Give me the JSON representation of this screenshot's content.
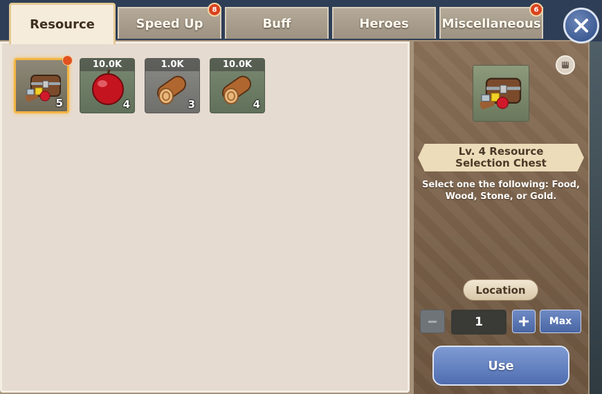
{
  "tabs": [
    {
      "label": "Resource",
      "active": true,
      "badge": null
    },
    {
      "label": "Speed Up",
      "active": false,
      "badge": "8"
    },
    {
      "label": "Buff",
      "active": false,
      "badge": null
    },
    {
      "label": "Heroes",
      "active": false,
      "badge": null
    },
    {
      "label": "Miscellaneous",
      "active": false,
      "badge": "6"
    }
  ],
  "close_icon": "close-icon",
  "inventory": [
    {
      "icon": "chest-icon",
      "amount_label": "",
      "count": "5",
      "selected": true,
      "new": true
    },
    {
      "icon": "apple-icon",
      "amount_label": "10.0K",
      "count": "4",
      "selected": false,
      "new": false
    },
    {
      "icon": "log-icon",
      "amount_label": "1.0K",
      "count": "3",
      "selected": false,
      "new": false
    },
    {
      "icon": "log-icon",
      "amount_label": "10.0K",
      "count": "4",
      "selected": false,
      "new": false
    }
  ],
  "detail": {
    "icon": "chest-icon",
    "name": "Lv. 4 Resource Selection Chest",
    "description": "Select one the following: Food, Wood, Stone, or Gold.",
    "location_label": "Location",
    "quantity": "1",
    "max_label": "Max",
    "use_label": "Use"
  },
  "colors": {
    "active_tab_bg": "#f6ecdb",
    "badge": "#d9421e",
    "button_blue": "#4f6db0",
    "selected_border": "#f2b443"
  }
}
